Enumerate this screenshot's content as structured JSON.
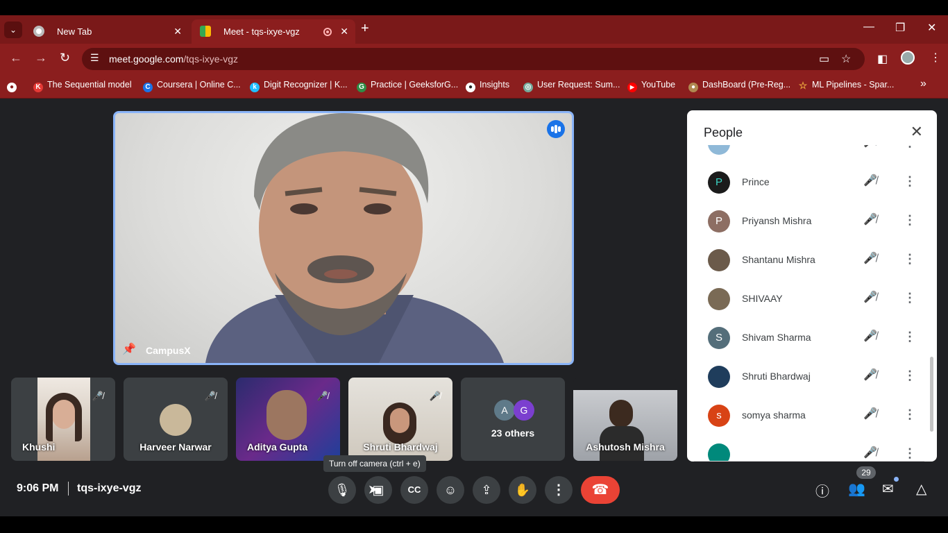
{
  "browser": {
    "tabs": [
      {
        "title": "New Tab",
        "close": "✕"
      },
      {
        "title": "Meet - tqs-ixye-vgz",
        "close": "✕"
      }
    ],
    "tab_dropdown": "⌄",
    "new_tab": "+",
    "window_controls": {
      "minimize": "—",
      "restore": "❐",
      "close": "✕"
    },
    "url_host": "meet.google.com",
    "url_path": "/tqs-ixye-vgz",
    "nav": {
      "back": "←",
      "forward": "→",
      "reload": "↻"
    },
    "bookmarks": [
      {
        "label": "The Sequential model",
        "icon": "K",
        "color": "#e53935"
      },
      {
        "label": "Coursera | Online C...",
        "icon": "C",
        "color": "#1a73e8"
      },
      {
        "label": "Digit Recognizer | K...",
        "icon": "k",
        "color": "#20beff"
      },
      {
        "label": "Practice | GeeksforG...",
        "icon": "G",
        "color": "#2f8d46"
      },
      {
        "label": "Insights",
        "icon": "●",
        "color": "#222"
      },
      {
        "label": "User Request: Sum...",
        "icon": "◎",
        "color": "#74aa9c"
      },
      {
        "label": "YouTube",
        "icon": "▶",
        "color": "#ff0000"
      },
      {
        "label": "DashBoard (Pre-Reg...",
        "icon": "●",
        "color": "#b08850"
      },
      {
        "label": "ML Pipelines - Spar...",
        "icon": "☆",
        "color": "#e8a33d"
      }
    ],
    "bookmarks_more": "»"
  },
  "meet": {
    "main_speaker": "CampusX",
    "tiles": [
      {
        "name": "Khushi"
      },
      {
        "name": "Harveer Narwar"
      },
      {
        "name": "Aditya Gupta"
      },
      {
        "name": "Shruti Bhardwaj"
      },
      {
        "name": "23 others",
        "avatars": [
          "A",
          "G"
        ]
      },
      {
        "name": "Ashutosh Mishra"
      }
    ],
    "tooltip": "Turn off camera (ctrl + e)",
    "time": "9:06 PM",
    "meeting_code": "tqs-ixye-vgz",
    "people_count": "29"
  },
  "people_panel": {
    "title": "People",
    "participants": [
      {
        "name": "Prince",
        "initial": "P",
        "color": "#1b1b1b"
      },
      {
        "name": "Priyansh Mishra",
        "initial": "P",
        "color": "#8d6e63"
      },
      {
        "name": "Shantanu Mishra",
        "initial": "",
        "color": "#6b5a4a"
      },
      {
        "name": "SHIVAAY",
        "initial": "",
        "color": "#7a6a55"
      },
      {
        "name": "Shivam Sharma",
        "initial": "S",
        "color": "#546e7a"
      },
      {
        "name": "Shruti Bhardwaj",
        "initial": "",
        "color": "#1f3d5c"
      },
      {
        "name": "somya sharma",
        "initial": "s",
        "color": "#d84315"
      }
    ]
  }
}
